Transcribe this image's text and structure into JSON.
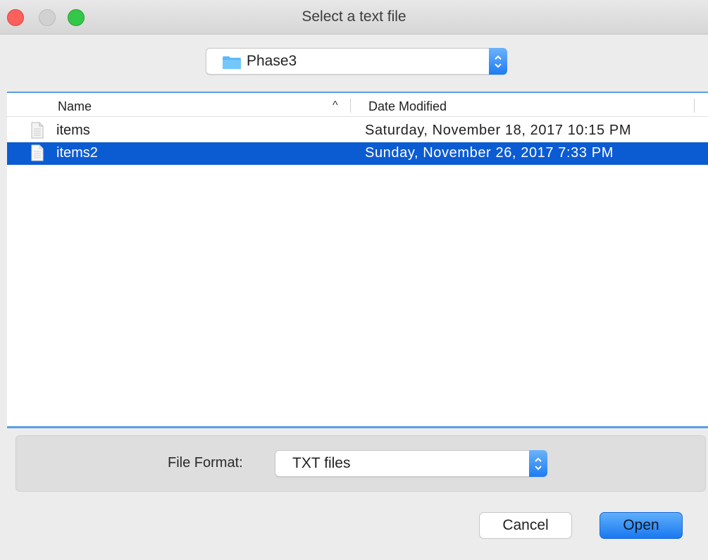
{
  "window": {
    "title": "Select a text file"
  },
  "location": {
    "folder": "Phase3",
    "folder_icon": "folder-icon"
  },
  "columns": {
    "name": "Name",
    "date_modified": "Date Modified",
    "sort_indicator": "^"
  },
  "files": [
    {
      "name": "items",
      "date": "Saturday, November 18, 2017 10:15 PM",
      "selected": false
    },
    {
      "name": "items2",
      "date": "Sunday, November 26, 2017 7:33 PM",
      "selected": true
    }
  ],
  "format": {
    "label": "File Format:",
    "value": "TXT files"
  },
  "buttons": {
    "cancel": "Cancel",
    "open": "Open"
  },
  "colors": {
    "selection": "#0b5bd3",
    "accent": "#1a78f0",
    "close": "#fc605c",
    "zoom": "#34c748"
  }
}
